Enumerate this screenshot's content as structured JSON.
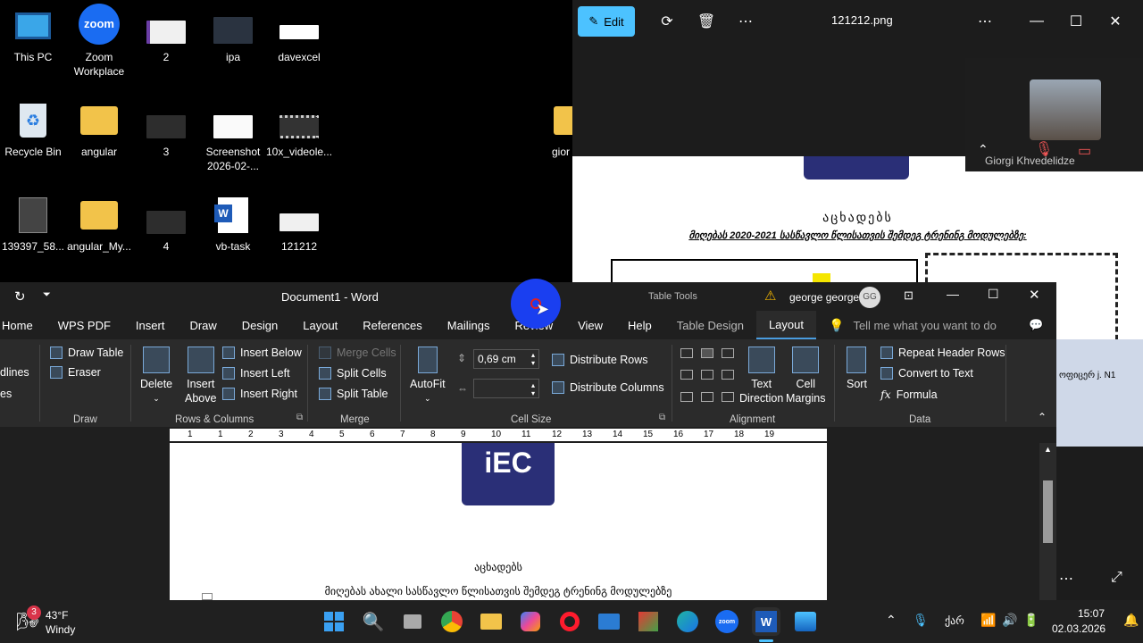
{
  "desktop": {
    "icons": [
      {
        "label": "This PC"
      },
      {
        "label": "Zoom Workplace"
      },
      {
        "label": "2"
      },
      {
        "label": "ipa"
      },
      {
        "label": "davexcel"
      },
      {
        "label": "Recycle Bin"
      },
      {
        "label": "angular"
      },
      {
        "label": "3"
      },
      {
        "label": "Screenshot 2026-02-..."
      },
      {
        "label": "10x_videole..."
      },
      {
        "label": "139397_58..."
      },
      {
        "label": "angular_My..."
      },
      {
        "label": "4"
      },
      {
        "label": "vb-task"
      },
      {
        "label": "121212"
      },
      {
        "label": "gior"
      }
    ]
  },
  "photos": {
    "edit_label": "Edit",
    "filename": "121212.png",
    "doc_heading": "აცხადებს",
    "doc_subheading": "მიღებას 2020-2021 სასწავლო წლისათვის შემდეგ ტრენინგ მოდულებზე:",
    "right_text": "ოფიცერ j. N1"
  },
  "zoom": {
    "participant": "Giorgi Khvedelidze"
  },
  "word": {
    "title": "Document1 - Word",
    "context": "Table Tools",
    "user": "george george",
    "user_initials": "GG",
    "tabs": [
      "Home",
      "WPS PDF",
      "Insert",
      "Draw",
      "Design",
      "Layout",
      "References",
      "Mailings",
      "Review",
      "View",
      "Help",
      "Table Design",
      "Layout"
    ],
    "search_placeholder": "Tell me what you want to do",
    "ribbon": {
      "cut_left_1": "dlines",
      "cut_left_2": "es",
      "draw_table": "Draw Table",
      "eraser": "Eraser",
      "draw_group": "Draw",
      "delete": "Delete",
      "insert_above_1": "Insert",
      "insert_above_2": "Above",
      "insert_below": "Insert Below",
      "insert_left": "Insert Left",
      "insert_right": "Insert Right",
      "rows_cols_group": "Rows & Columns",
      "merge_cells": "Merge Cells",
      "split_cells": "Split Cells",
      "split_table": "Split Table",
      "merge_group": "Merge",
      "autofit": "AutoFit",
      "height_value": "0,69 cm",
      "distribute_rows": "Distribute Rows",
      "distribute_columns": "Distribute Columns",
      "cell_size_group": "Cell Size",
      "text_direction_1": "Text",
      "text_direction_2": "Direction",
      "cell_margins_1": "Cell",
      "cell_margins_2": "Margins",
      "alignment_group": "Alignment",
      "sort": "Sort",
      "repeat_header": "Repeat Header Rows",
      "convert_text": "Convert to Text",
      "formula": "Formula",
      "data_group": "Data"
    },
    "ruler_marks": [
      "1",
      "1",
      "2",
      "3",
      "4",
      "5",
      "6",
      "7",
      "8",
      "9",
      "10",
      "11",
      "12",
      "13",
      "14",
      "15",
      "16",
      "17",
      "18",
      "19"
    ],
    "doc_logo": "iEC",
    "doc_heading": "აცხადებს",
    "doc_line": "მიღებას ახალი სასწავლო წლისათვის შემდეგ ტრენინგ მოდულებზე"
  },
  "taskbar": {
    "weather_temp": "43°F",
    "weather_desc": "Windy",
    "badge": "3",
    "lang": "ქარ",
    "time": "15:07",
    "date": "02.03.2026"
  }
}
